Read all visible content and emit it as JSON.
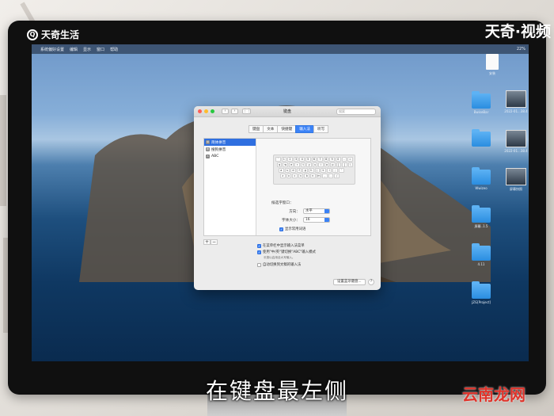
{
  "watermark": {
    "left_text": "天奇生活",
    "right_text": "天奇·视频"
  },
  "caption": "在键盘最左侧",
  "brand": "云南龙网",
  "menubar": {
    "apple": "",
    "items": [
      "系统偏好设置",
      "编辑",
      "显示",
      "窗口",
      "帮助"
    ],
    "battery": "22%"
  },
  "desktop_icons": [
    {
      "label": "安装"
    },
    {
      "label": "BwiseBar"
    },
    {
      "label": "屏幕快照"
    },
    {
      "label": "2022-01...38.4"
    },
    {
      "label": "屏幕快照"
    },
    {
      "label": "2022-01...38.4"
    },
    {
      "label": "Wwizeo"
    },
    {
      "label": "屏幕快照"
    },
    {
      "label": "屏幕..1.5"
    },
    {
      "label": "4.11"
    },
    {
      "label": "JZG[Project]"
    }
  ],
  "window": {
    "title": "键盘",
    "search_placeholder": "搜索",
    "tabs": [
      "键盘",
      "文本",
      "快捷键",
      "输入法",
      "听写"
    ],
    "sources": [
      {
        "label": "简体拼音",
        "icon": "拼"
      },
      {
        "label": "搜狗拼音",
        "icon": "搜"
      },
      {
        "label": "ABC",
        "icon": "A"
      }
    ],
    "keyboard_rows": [
      [
        "`",
        "1",
        "2",
        "3",
        "4",
        "5",
        "6",
        "7",
        "8",
        "9",
        "0",
        "-",
        "="
      ],
      [
        "q",
        "w",
        "e",
        "r",
        "t",
        "y",
        "u",
        "i",
        "o",
        "p",
        "[",
        "]",
        "\\"
      ],
      [
        "a",
        "s",
        "d",
        "f",
        "g",
        "h",
        "j",
        "k",
        "l",
        ";",
        "'"
      ],
      [
        "z",
        "x",
        "c",
        "v",
        "b",
        "n",
        "m",
        ",",
        ".",
        "/"
      ]
    ],
    "options_title": "候选字窗口：",
    "orientation_label": "方向：",
    "orientation_value": "水平",
    "font_size_label": "字体大小：",
    "font_size_value": "16",
    "show_common_phrases": "显示常用词语",
    "show_in_menu": "在菜单栏中显示输入法菜单",
    "use_caps": "使用\"中/英\"键切换\"ABC\"输入模式",
    "use_caps_note": "长按以启用全大写输入。",
    "auto_switch": "自动切换到文稿的输入法",
    "setup_button": "设置蓝牙键盘...",
    "help_button": "?"
  }
}
